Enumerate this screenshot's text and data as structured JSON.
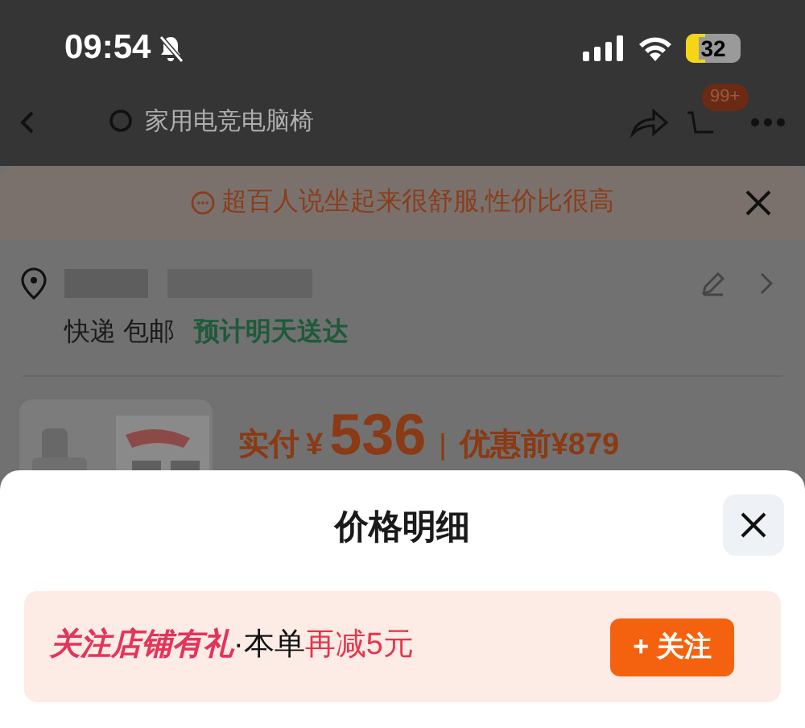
{
  "status_bar": {
    "time": "09:54",
    "battery": "32"
  },
  "nav": {
    "search_placeholder": "家用电竞电脑椅",
    "cart_badge": "99+"
  },
  "banner": {
    "text": "超百人说坐起来很舒服,性价比很高"
  },
  "address": {
    "shipping": "快递 包邮",
    "delivery": "预计明天送达"
  },
  "product": {
    "paid_label": "实付",
    "paid_price": "¥",
    "paid_amount": "536",
    "separator": "|",
    "original": "优惠前¥879"
  },
  "sheet": {
    "title": "价格明细",
    "promo": {
      "lead": "关注店铺有礼",
      "middle": "·本单",
      "highlight": "再减5元"
    },
    "follow_button": "+ 关注"
  }
}
